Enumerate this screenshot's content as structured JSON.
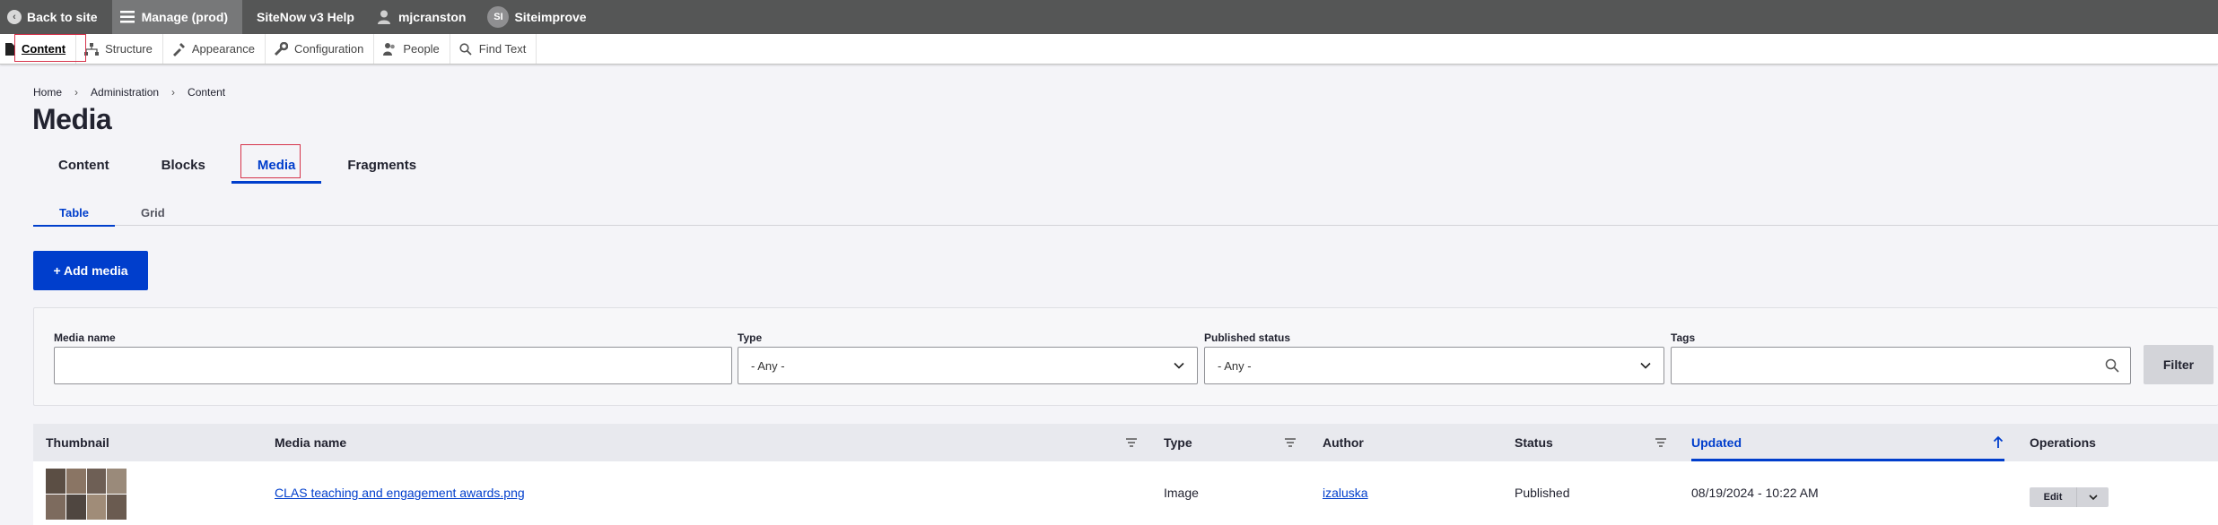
{
  "toolbar": {
    "back": "Back to site",
    "manage": "Manage (prod)",
    "help": "SiteNow v3 Help",
    "user": "mjcranston",
    "siteimprove_badge": "SI",
    "siteimprove": "Siteimprove"
  },
  "tray": {
    "items": [
      "Content",
      "Structure",
      "Appearance",
      "Configuration",
      "People",
      "Find Text"
    ]
  },
  "breadcrumb": [
    "Home",
    "Administration",
    "Content"
  ],
  "page_title": "Media",
  "primary_tabs": [
    "Content",
    "Blocks",
    "Media",
    "Fragments"
  ],
  "primary_tab_active": "Media",
  "secondary_tabs": [
    "Table",
    "Grid"
  ],
  "secondary_tab_active": "Table",
  "add_media": "+ Add media",
  "filters": {
    "media_name_label": "Media name",
    "media_name_value": "",
    "type_label": "Type",
    "type_value": "- Any -",
    "status_label": "Published status",
    "status_value": "- Any -",
    "tags_label": "Tags",
    "tags_value": "",
    "filter_button": "Filter"
  },
  "table": {
    "headers": [
      "Thumbnail",
      "Media name",
      "Type",
      "Author",
      "Status",
      "Updated",
      "Operations"
    ],
    "sorted_column": "Updated",
    "rows": [
      {
        "media_name": "CLAS teaching and engagement awards.png",
        "type": "Image",
        "author": "izaluska",
        "status": "Published",
        "updated": "08/19/2024 - 10:22 AM",
        "operation": "Edit"
      }
    ]
  },
  "colors": {
    "accent": "#003ecc",
    "toolbar": "#555656",
    "highlight": "#d6334b"
  }
}
